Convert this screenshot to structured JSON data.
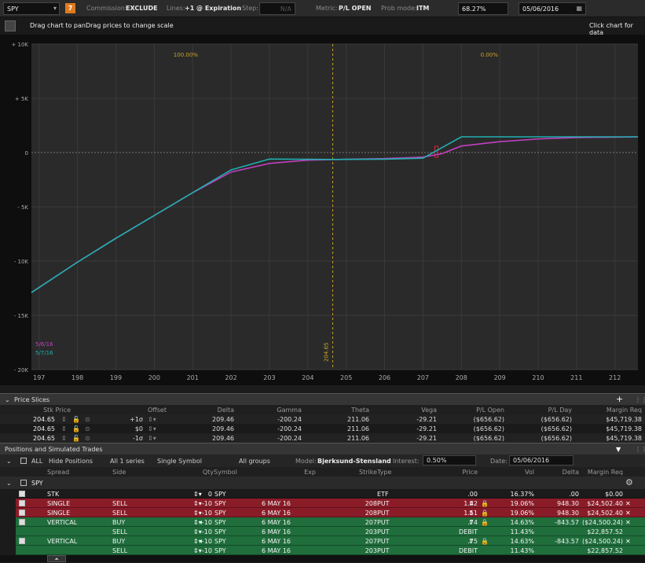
{
  "toolbar": {
    "symbol": "SPY",
    "badge": "7",
    "commission_label": "Commission:",
    "commission": "EXCLUDE",
    "lines_label": "Lines:",
    "lines": "+1 @ Expiration",
    "step_label": "Step:",
    "step_value": "N/A",
    "metric_label": "Metric:",
    "metric": "P/L OPEN",
    "prob_label": "Prob mode:",
    "prob_mode": "ITM",
    "pct": "68.27%",
    "date": "05/06/2016"
  },
  "hint": {
    "left": "Drag chart to panDrag prices to change scale",
    "right": "Click chart for data"
  },
  "chart_data": {
    "type": "line",
    "title": "",
    "xlabel": "",
    "ylabel": "",
    "xlim": [
      196.8,
      212.6
    ],
    "ylim": [
      -20000,
      10000
    ],
    "x_ticks": [
      "197",
      "198",
      "199",
      "200",
      "201",
      "202",
      "203",
      "204",
      "205",
      "206",
      "207",
      "208",
      "209",
      "210",
      "211",
      "212"
    ],
    "y_ticks": [
      "+ 10K",
      "+ 5K",
      "0",
      "- 5K",
      "- 10K",
      "- 15K",
      "- 20K"
    ],
    "y_tick_values": [
      10000,
      5000,
      0,
      -5000,
      -10000,
      -15000,
      -20000
    ],
    "marker_price": "204.65",
    "marker_x": 204.65,
    "left_pct": "100.00%",
    "right_pct": "0.00%",
    "series": [
      {
        "name": "5/6/16",
        "color": "#c040c0",
        "x": [
          196.8,
          198,
          199,
          200,
          201,
          202,
          203,
          204,
          204.65,
          205,
          206,
          207,
          207.5,
          208,
          209,
          210,
          211,
          212,
          212.6
        ],
        "y": [
          -12900,
          -10100,
          -7900,
          -5800,
          -3700,
          -1800,
          -1000,
          -700,
          -650,
          -620,
          -560,
          -420,
          -100,
          600,
          1000,
          1250,
          1380,
          1420,
          1440
        ]
      },
      {
        "name": "5/7/16",
        "color": "#20b0b0",
        "x": [
          196.8,
          198,
          199,
          200,
          201,
          202,
          203,
          204,
          204.65,
          205,
          206,
          207,
          208,
          209,
          210,
          211,
          212,
          212.6
        ],
        "y": [
          -12900,
          -10100,
          -7900,
          -5800,
          -3700,
          -1600,
          -600,
          -620,
          -640,
          -630,
          -610,
          -520,
          1450,
          1450,
          1450,
          1450,
          1450,
          1450
        ]
      }
    ]
  },
  "price_slices": {
    "title": "Price Slices",
    "headers": [
      "Stk Price",
      "Offset",
      "Delta",
      "Gamma",
      "Theta",
      "Vega",
      "P/L Open",
      "P/L Day",
      "Margin Req"
    ],
    "rows": [
      [
        "204.65",
        "+1σ",
        "209.46",
        "-200.24",
        "211.06",
        "-29.21",
        "($656.62)",
        "($656.62)",
        "$45,719.38"
      ],
      [
        "204.65",
        "$0",
        "209.46",
        "-200.24",
        "211.06",
        "-29.21",
        "($656.62)",
        "($656.62)",
        "$45,719.38"
      ],
      [
        "204.65",
        "-1σ",
        "209.46",
        "-200.24",
        "211.06",
        "-29.21",
        "($656.62)",
        "($656.62)",
        "$45,719.38"
      ]
    ]
  },
  "positions": {
    "title": "Positions and Simulated Trades",
    "all": "ALL",
    "hide": "Hide Positions",
    "series": "All 1 series",
    "symbol": "Single Symbol",
    "groups": "All groups",
    "model_label": "Model:",
    "model": "Bjerksund-Stensland",
    "interest_label": "Interest:",
    "interest": "0.50%",
    "date_label": "Date:",
    "date": "05/06/2016",
    "headers": [
      "Spread",
      "Side",
      "Qty",
      "Symbol",
      "Exp",
      "Strike",
      "Type",
      "Price",
      "Vol",
      "Delta",
      "Margin Req"
    ],
    "group": "SPY",
    "rows": [
      {
        "style": "dk",
        "check": true,
        "spread": "STK",
        "side": "",
        "qty": "0",
        "sym": "SPY",
        "exp": "",
        "strike": "",
        "type": "ETF",
        "price": ".00",
        "vol": "16.37%",
        "delta": ".00",
        "margin": "$0.00"
      },
      {
        "style": "red",
        "check": true,
        "spread": "SINGLE",
        "side": "SELL",
        "qty": "-10",
        "sym": "SPY",
        "exp": "6 MAY 16",
        "strike": "208",
        "type": "PUT",
        "price": "1.42",
        "vol": "19.06%",
        "delta": "948.30",
        "margin": "$24,502.40"
      },
      {
        "style": "red",
        "check": true,
        "spread": "SINGLE",
        "side": "SELL",
        "qty": "-10",
        "sym": "SPY",
        "exp": "6 MAY 16",
        "strike": "208",
        "type": "PUT",
        "price": "1.51",
        "vol": "19.06%",
        "delta": "948.30",
        "margin": "$24,502.40"
      },
      {
        "style": "grn",
        "check": true,
        "spread": "VERTICAL",
        "side": "BUY",
        "qty": "+10",
        "sym": "SPY",
        "exp": "6 MAY 16",
        "strike": "207",
        "type": "PUT",
        "price": ".74",
        "vol": "14.63%",
        "delta": "-843.57",
        "margin": "($24,500.24)"
      },
      {
        "style": "grn",
        "check": false,
        "spread": "",
        "side": "SELL",
        "qty": "-10",
        "sym": "SPY",
        "exp": "6 MAY 16",
        "strike": "203",
        "type": "PUT",
        "price": "DEBIT",
        "vol": "11.43%",
        "delta": "",
        "margin": "$22,857.52"
      },
      {
        "style": "grn",
        "check": true,
        "spread": "VERTICAL",
        "side": "BUY",
        "qty": "+10",
        "sym": "SPY",
        "exp": "6 MAY 16",
        "strike": "207",
        "type": "PUT",
        "price": ".75",
        "vol": "14.63%",
        "delta": "-843.57",
        "margin": "($24,500.24)"
      },
      {
        "style": "grn",
        "check": false,
        "spread": "",
        "side": "SELL",
        "qty": "-10",
        "sym": "SPY",
        "exp": "6 MAY 16",
        "strike": "203",
        "type": "PUT",
        "price": "DEBIT",
        "vol": "11.43%",
        "delta": "",
        "margin": "$22,857.52"
      }
    ]
  }
}
